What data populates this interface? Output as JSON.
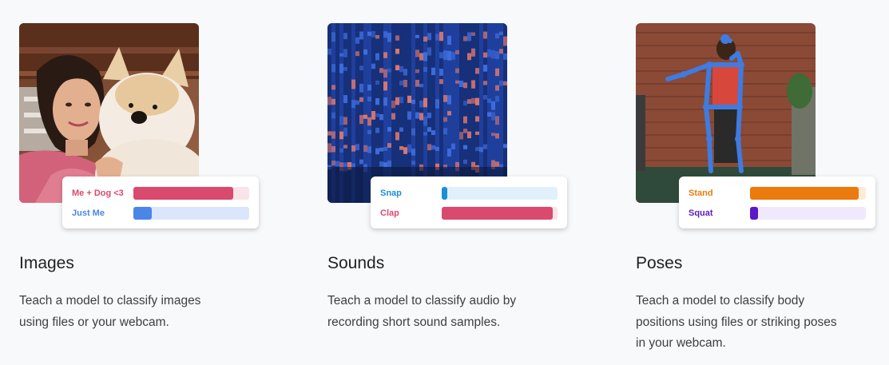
{
  "cards": [
    {
      "title": "Images",
      "description_lines": [
        "Teach a model to classify images",
        "using files or your webcam."
      ],
      "results": [
        {
          "label": "Me + Dog <3",
          "value": 0.86,
          "color": "#d94a6e",
          "track": "#fbe4e9"
        },
        {
          "label": "Just Me",
          "value": 0.16,
          "color": "#4a86e8",
          "track": "#dae6fb"
        }
      ]
    },
    {
      "title": "Sounds",
      "description_lines": [
        "Teach a model to classify audio by",
        "recording short sound samples."
      ],
      "results": [
        {
          "label": "Snap",
          "value": 0.05,
          "color": "#1a8fd4",
          "track": "#e0f1fb"
        },
        {
          "label": "Clap",
          "value": 0.96,
          "color": "#d94a6e",
          "track": "#fbe4e9"
        }
      ]
    },
    {
      "title": "Poses",
      "description_lines": [
        "Teach a model to classify body",
        "positions using files or striking poses",
        "in your webcam."
      ],
      "results": [
        {
          "label": "Stand",
          "value": 0.94,
          "color": "#ea7b0c",
          "track": "#fdebd9"
        },
        {
          "label": "Squat",
          "value": 0.07,
          "color": "#5b19c7",
          "track": "#efe9fb"
        }
      ]
    }
  ]
}
